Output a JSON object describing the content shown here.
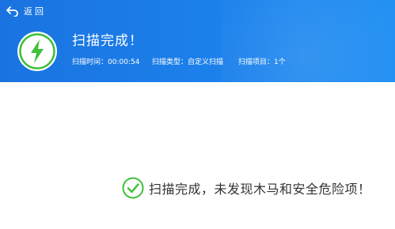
{
  "header": {
    "back_label": "返回",
    "title": "扫描完成！",
    "meta": {
      "time": "扫描时间：00:00:54",
      "type": "扫描类型：自定义扫描",
      "items": "扫描项目：1个"
    }
  },
  "result": {
    "message": "扫描完成，未发现木马和安全危险项！"
  },
  "icons": {
    "back": "back-arrow-icon",
    "status": "lightning-bolt-icon",
    "result": "check-circle-icon"
  },
  "colors": {
    "header_blue": "#1c82ec",
    "icon_green": "#3fbf3a",
    "text_dark": "#333333"
  }
}
